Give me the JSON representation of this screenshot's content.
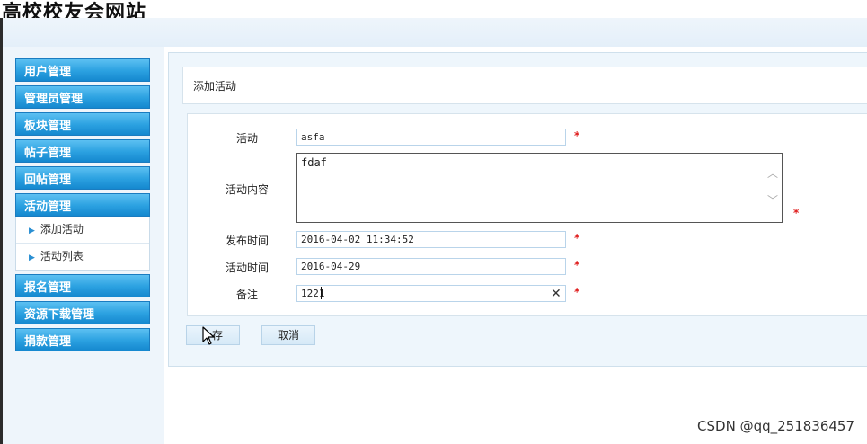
{
  "site": {
    "title": "高校校友会网站"
  },
  "sidebar": {
    "menus": [
      {
        "label": "用户管理"
      },
      {
        "label": "管理员管理"
      },
      {
        "label": "板块管理"
      },
      {
        "label": "帖子管理"
      },
      {
        "label": "回帖管理"
      },
      {
        "label": "活动管理",
        "expanded": true,
        "items": [
          {
            "label": "添加活动"
          },
          {
            "label": "活动列表"
          }
        ]
      },
      {
        "label": "报名管理"
      },
      {
        "label": "资源下载管理"
      },
      {
        "label": "捐款管理"
      }
    ]
  },
  "panel": {
    "title": "添加活动"
  },
  "form": {
    "activity": {
      "label": "活动",
      "value": "asfa",
      "required": "*"
    },
    "content": {
      "label": "活动内容",
      "value": "fdaf",
      "required": "*"
    },
    "publish_time": {
      "label": "发布时间",
      "value": "2016-04-02 11:34:52",
      "required": "*"
    },
    "activity_time": {
      "label": "活动时间",
      "value": "2016-04-29",
      "required": "*"
    },
    "remark": {
      "label": "备注",
      "value": "1221",
      "required": "*"
    }
  },
  "buttons": {
    "save": "保存",
    "save_visible": "存",
    "cancel": "取消"
  },
  "watermark": "CSDN @qq_251836457",
  "icons": {
    "expand_arrow": "triangle-right",
    "clear": "close-x",
    "pointer": "mouse-cursor"
  }
}
